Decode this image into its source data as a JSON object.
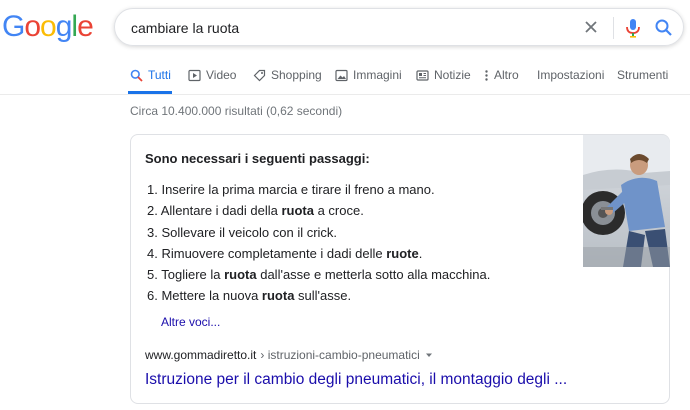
{
  "logo": {
    "letters": [
      "G",
      "o",
      "o",
      "g",
      "l",
      "e"
    ],
    "colors": [
      "#4285F4",
      "#EA4335",
      "#FBBC05",
      "#4285F4",
      "#34A853",
      "#EA4335"
    ]
  },
  "search": {
    "query": "cambiare la ruota",
    "icons": [
      "close-icon",
      "microphone-icon",
      "search-icon"
    ]
  },
  "tabs": [
    {
      "label": "Tutti",
      "icon": "search-icon",
      "active": true
    },
    {
      "label": "Video",
      "icon": "play-icon"
    },
    {
      "label": "Shopping",
      "icon": "tag-icon"
    },
    {
      "label": "Immagini",
      "icon": "image-icon"
    },
    {
      "label": "Notizie",
      "icon": "news-icon"
    },
    {
      "label": "Altro",
      "icon": "more-vert-icon"
    },
    {
      "label": "Impostazioni"
    },
    {
      "label": "Strumenti"
    }
  ],
  "result_stats": "Circa 10.400.000 risultati (0,62 secondi)",
  "snippet": {
    "heading": "Sono necessari i seguenti passaggi:",
    "steps": [
      {
        "num": "1.",
        "parts": [
          {
            "t": "Inserire la prima marcia e tirare il freno a mano."
          }
        ]
      },
      {
        "num": "2.",
        "parts": [
          {
            "t": "Allentare i dadi della "
          },
          {
            "t": "ruota",
            "b": true
          },
          {
            "t": " a croce."
          }
        ]
      },
      {
        "num": "3.",
        "parts": [
          {
            "t": "Sollevare il veicolo con il crick."
          }
        ]
      },
      {
        "num": "4.",
        "parts": [
          {
            "t": "Rimuovere completamente i dadi delle "
          },
          {
            "t": "ruote",
            "b": true
          },
          {
            "t": "."
          }
        ]
      },
      {
        "num": "5.",
        "parts": [
          {
            "t": "Togliere la "
          },
          {
            "t": "ruota",
            "b": true
          },
          {
            "t": " dall'asse e metterla sotto alla macchina."
          }
        ]
      },
      {
        "num": "6.",
        "parts": [
          {
            "t": "Mettere la nuova "
          },
          {
            "t": "ruota",
            "b": true
          },
          {
            "t": " sull'asse."
          }
        ]
      }
    ],
    "more_link": "Altre voci...",
    "image_alt": "Man changing a car tire",
    "cite_domain": "www.gommadiretto.it",
    "cite_path": " › istruzioni-cambio-pneumatici",
    "title": "Istruzione per il cambio degli pneumatici, il montaggio degli ..."
  },
  "colors": {
    "link": "#1a0dab",
    "accent": "#1a73e8",
    "muted": "#5f6368"
  }
}
